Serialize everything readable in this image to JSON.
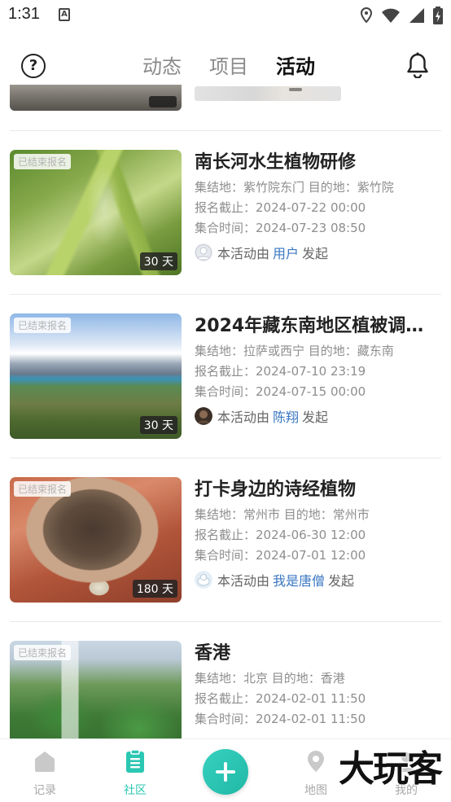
{
  "status_bar": {
    "time": "1:31",
    "notification_icon": "a-box-icon",
    "icons": [
      "location-icon",
      "wifi-icon",
      "signal-icon",
      "battery-icon"
    ]
  },
  "header": {
    "help_icon": "question-circle-icon",
    "tabs": [
      {
        "label": "动态",
        "active": false
      },
      {
        "label": "项目",
        "active": false
      },
      {
        "label": "活动",
        "active": true
      }
    ],
    "bell_icon": "bell-icon"
  },
  "activities": [
    {
      "title": "南长河水生植物研修",
      "status_badge": "已结束报名",
      "duration": "30 天",
      "location_line": "集结地：紫竹院东门  目的地：紫竹院",
      "signup_deadline": "报名截止：2024-07-22  00:00",
      "gather_time": "集合时间：2024-07-23  08:50",
      "creator_prefix": "本活动由",
      "creator_name": "用户",
      "creator_suffix": "发起"
    },
    {
      "title": "2024年藏东南地区植被调查...",
      "status_badge": "已结束报名",
      "duration": "30 天",
      "location_line": "集结地：拉萨或西宁  目的地：藏东南",
      "signup_deadline": "报名截止：2024-07-10  23:19",
      "gather_time": "集合时间：2024-07-15  00:00",
      "creator_prefix": "本活动由",
      "creator_name": "陈翔",
      "creator_suffix": "发起"
    },
    {
      "title": "打卡身边的诗经植物",
      "status_badge": "已结束报名",
      "duration": "180 天",
      "location_line": "集结地：常州市  目的地：常州市",
      "signup_deadline": "报名截止：2024-06-30  12:00",
      "gather_time": "集合时间：2024-07-01  12:00",
      "creator_prefix": "本活动由",
      "creator_name": "我是唐僧",
      "creator_suffix": "发起"
    },
    {
      "title": "香港",
      "status_badge": "已结束报名",
      "location_line": "集结地：北京  目的地：香港",
      "signup_deadline": "报名截止：2024-02-01  11:50",
      "gather_time": "集合时间：2024-02-01  11:50"
    }
  ],
  "bottom_nav": {
    "items": [
      {
        "label": "记录",
        "icon": "home-icon",
        "active": false
      },
      {
        "label": "社区",
        "icon": "clipboard-icon",
        "active": true
      },
      {
        "label": "地图",
        "icon": "map-pin-icon",
        "active": false
      },
      {
        "label": "我的",
        "icon": "user-icon",
        "active": false
      }
    ],
    "add_icon": "plus-icon"
  },
  "watermark": "大玩客",
  "colors": {
    "accent": "#2bc7b3",
    "link": "#3a77c2"
  }
}
